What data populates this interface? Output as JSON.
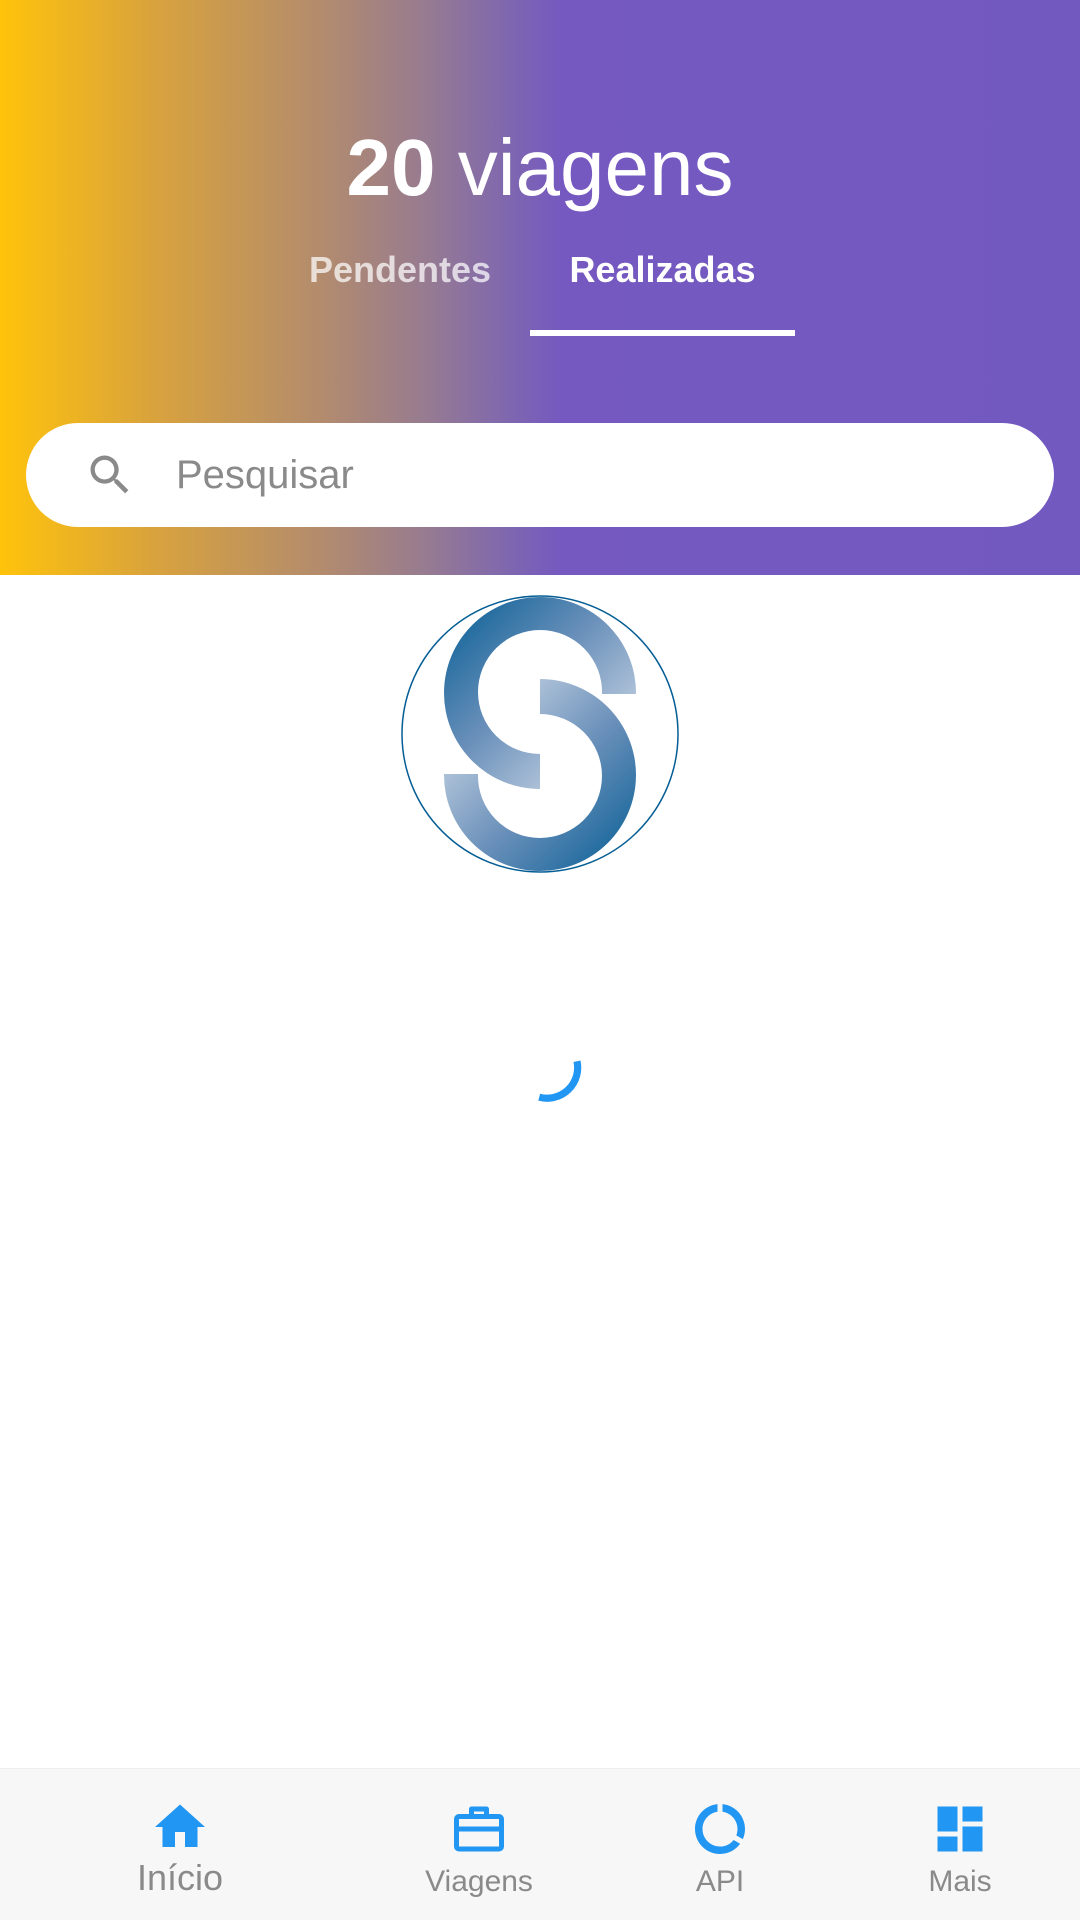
{
  "header": {
    "count": "20",
    "count_word": "viagens",
    "tabs": [
      {
        "label": "Pendentes"
      },
      {
        "label": "Realizadas"
      }
    ],
    "active_tab": "Realizadas"
  },
  "search": {
    "placeholder": "Pesquisar",
    "value": "",
    "icon": "search-icon"
  },
  "content": {
    "logo": "company-logo",
    "loading": true
  },
  "bottom_nav": {
    "items": [
      {
        "label": "Início",
        "icon": "home-icon",
        "active": true
      },
      {
        "label": "Viagens",
        "icon": "briefcase-icon",
        "active": false
      },
      {
        "label": "API",
        "icon": "donut-icon",
        "active": false
      },
      {
        "label": "Mais",
        "icon": "dashboard-icon",
        "active": false
      }
    ]
  },
  "colors": {
    "gradient_start": "#FFC30B",
    "gradient_end": "#7259C0",
    "accent": "#2196F3",
    "logo_blue": "#045D94"
  }
}
